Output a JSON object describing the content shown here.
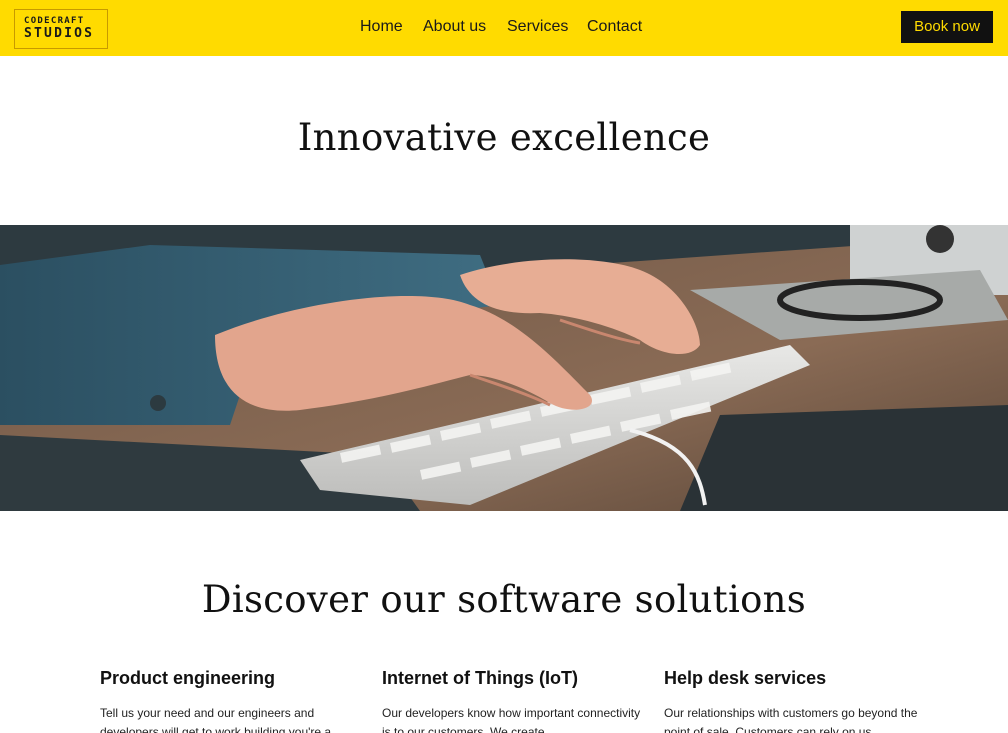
{
  "header": {
    "logo_line1": "CODECRAFT",
    "logo_line2": "STUDIOS",
    "nav": [
      "Home",
      "About us",
      "Services",
      "Contact"
    ],
    "cta_label": "Book now"
  },
  "hero": {
    "title": "Innovative excellence"
  },
  "solutions": {
    "title": "Discover our software solutions",
    "items": [
      {
        "title": "Product engineering",
        "text": "Tell us your need and our engineers and developers will get to work building you're a"
      },
      {
        "title": "Internet of Things (IoT)",
        "text": "Our developers know how important connectivity is to our customers. We create"
      },
      {
        "title": "Help desk services",
        "text": "Our relationships with customers go beyond the point of sale. Customers can rely on us"
      }
    ]
  },
  "colors": {
    "brand_yellow": "#ffdb00",
    "button_black": "#111111"
  }
}
